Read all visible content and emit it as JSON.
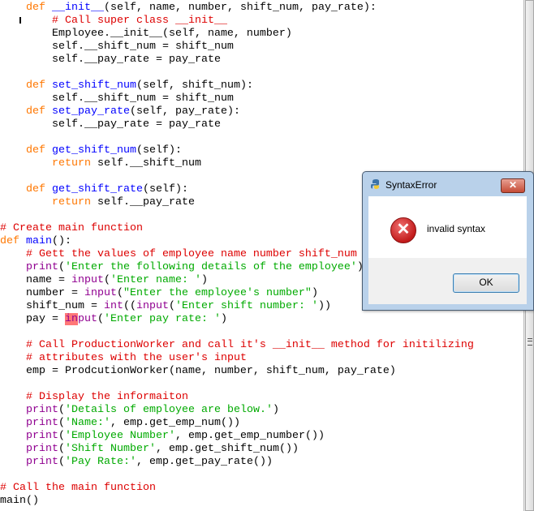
{
  "code": {
    "lines": [
      [
        {
          "t": "    ",
          "c": "n"
        },
        {
          "t": "def",
          "c": "k"
        },
        {
          "t": " ",
          "c": "n"
        },
        {
          "t": "__init__",
          "c": "d"
        },
        {
          "t": "(self, name, number, shift_num, pay_rate):",
          "c": "n"
        }
      ],
      [
        {
          "t": "        ",
          "c": "n"
        },
        {
          "t": "# Call super class __init__",
          "c": "c"
        }
      ],
      [
        {
          "t": "        Employee.__init__(self, name, number)",
          "c": "n"
        }
      ],
      [
        {
          "t": "        self.__shift_num = shift_num",
          "c": "n"
        }
      ],
      [
        {
          "t": "        self.__pay_rate = pay_rate",
          "c": "n"
        }
      ],
      [],
      [
        {
          "t": "    ",
          "c": "n"
        },
        {
          "t": "def",
          "c": "k"
        },
        {
          "t": " ",
          "c": "n"
        },
        {
          "t": "set_shift_num",
          "c": "d"
        },
        {
          "t": "(self, shift_num):",
          "c": "n"
        }
      ],
      [
        {
          "t": "        self.__shift_num = shift_num",
          "c": "n"
        }
      ],
      [
        {
          "t": "    ",
          "c": "n"
        },
        {
          "t": "def",
          "c": "k"
        },
        {
          "t": " ",
          "c": "n"
        },
        {
          "t": "set_pay_rate",
          "c": "d"
        },
        {
          "t": "(self, pay_rate):",
          "c": "n"
        }
      ],
      [
        {
          "t": "        self.__pay_rate = pay_rate",
          "c": "n"
        }
      ],
      [],
      [
        {
          "t": "    ",
          "c": "n"
        },
        {
          "t": "def",
          "c": "k"
        },
        {
          "t": " ",
          "c": "n"
        },
        {
          "t": "get_shift_num",
          "c": "d"
        },
        {
          "t": "(self):",
          "c": "n"
        }
      ],
      [
        {
          "t": "        ",
          "c": "n"
        },
        {
          "t": "return",
          "c": "k"
        },
        {
          "t": " self.__shift_num",
          "c": "n"
        }
      ],
      [],
      [
        {
          "t": "    ",
          "c": "n"
        },
        {
          "t": "def",
          "c": "k"
        },
        {
          "t": " ",
          "c": "n"
        },
        {
          "t": "get_shift_rate",
          "c": "d"
        },
        {
          "t": "(self):",
          "c": "n"
        }
      ],
      [
        {
          "t": "        ",
          "c": "n"
        },
        {
          "t": "return",
          "c": "k"
        },
        {
          "t": " self.__pay_rate",
          "c": "n"
        }
      ],
      [],
      [
        {
          "t": "# Create main function",
          "c": "c"
        }
      ],
      [
        {
          "t": "def",
          "c": "k"
        },
        {
          "t": " ",
          "c": "n"
        },
        {
          "t": "main",
          "c": "d"
        },
        {
          "t": "():",
          "c": "n"
        }
      ],
      [
        {
          "t": "    ",
          "c": "n"
        },
        {
          "t": "# Gett the values of employee name number shift_num",
          "c": "c"
        }
      ],
      [
        {
          "t": "    ",
          "c": "n"
        },
        {
          "t": "print",
          "c": "b"
        },
        {
          "t": "(",
          "c": "n"
        },
        {
          "t": "'Enter the following details of the employee'",
          "c": "s"
        },
        {
          "t": ")",
          "c": "n"
        }
      ],
      [
        {
          "t": "    name = ",
          "c": "n"
        },
        {
          "t": "input",
          "c": "b"
        },
        {
          "t": "(",
          "c": "n"
        },
        {
          "t": "'Enter name: '",
          "c": "s"
        },
        {
          "t": ")",
          "c": "n"
        }
      ],
      [
        {
          "t": "    number = ",
          "c": "n"
        },
        {
          "t": "input",
          "c": "b"
        },
        {
          "t": "(",
          "c": "n"
        },
        {
          "t": "\"Enter the employee's number\"",
          "c": "s"
        },
        {
          "t": ")",
          "c": "n"
        }
      ],
      [
        {
          "t": "    shift_num = ",
          "c": "n"
        },
        {
          "t": "int",
          "c": "b"
        },
        {
          "t": "((",
          "c": "n"
        },
        {
          "t": "input",
          "c": "b"
        },
        {
          "t": "(",
          "c": "n"
        },
        {
          "t": "'Enter shift number: '",
          "c": "s"
        },
        {
          "t": "))",
          "c": "n"
        }
      ],
      [
        {
          "t": "    pay = ",
          "c": "n"
        },
        {
          "t": "in",
          "c": "b err"
        },
        {
          "t": "put",
          "c": "b"
        },
        {
          "t": "(",
          "c": "n"
        },
        {
          "t": "'Enter pay rate: '",
          "c": "s"
        },
        {
          "t": ")",
          "c": "n"
        }
      ],
      [],
      [
        {
          "t": "    ",
          "c": "n"
        },
        {
          "t": "# Call ProductionWorker and call it's __init__ method for initilizing",
          "c": "c"
        }
      ],
      [
        {
          "t": "    ",
          "c": "n"
        },
        {
          "t": "# attributes with the user's input",
          "c": "c"
        }
      ],
      [
        {
          "t": "    emp = ProdcutionWorker(name, number, shift_num, pay_rate)",
          "c": "n"
        }
      ],
      [],
      [
        {
          "t": "    ",
          "c": "n"
        },
        {
          "t": "# Display the informaiton",
          "c": "c"
        }
      ],
      [
        {
          "t": "    ",
          "c": "n"
        },
        {
          "t": "print",
          "c": "b"
        },
        {
          "t": "(",
          "c": "n"
        },
        {
          "t": "'Details of employee are below.'",
          "c": "s"
        },
        {
          "t": ")",
          "c": "n"
        }
      ],
      [
        {
          "t": "    ",
          "c": "n"
        },
        {
          "t": "print",
          "c": "b"
        },
        {
          "t": "(",
          "c": "n"
        },
        {
          "t": "'Name:'",
          "c": "s"
        },
        {
          "t": ", emp.get_emp_num())",
          "c": "n"
        }
      ],
      [
        {
          "t": "    ",
          "c": "n"
        },
        {
          "t": "print",
          "c": "b"
        },
        {
          "t": "(",
          "c": "n"
        },
        {
          "t": "'Employee Number'",
          "c": "s"
        },
        {
          "t": ", emp.get_emp_number())",
          "c": "n"
        }
      ],
      [
        {
          "t": "    ",
          "c": "n"
        },
        {
          "t": "print",
          "c": "b"
        },
        {
          "t": "(",
          "c": "n"
        },
        {
          "t": "'Shift Number'",
          "c": "s"
        },
        {
          "t": ", emp.get_shift_num())",
          "c": "n"
        }
      ],
      [
        {
          "t": "    ",
          "c": "n"
        },
        {
          "t": "print",
          "c": "b"
        },
        {
          "t": "(",
          "c": "n"
        },
        {
          "t": "'Pay Rate:'",
          "c": "s"
        },
        {
          "t": ", emp.get_pay_rate())",
          "c": "n"
        }
      ],
      [],
      [
        {
          "t": "# Call the main function",
          "c": "c"
        }
      ],
      [
        {
          "t": "main()",
          "c": "n"
        }
      ]
    ]
  },
  "dialog": {
    "title": "SyntaxError",
    "close_glyph": "✕",
    "error_glyph": "✕",
    "message": "invalid syntax",
    "ok_label": "OK"
  }
}
